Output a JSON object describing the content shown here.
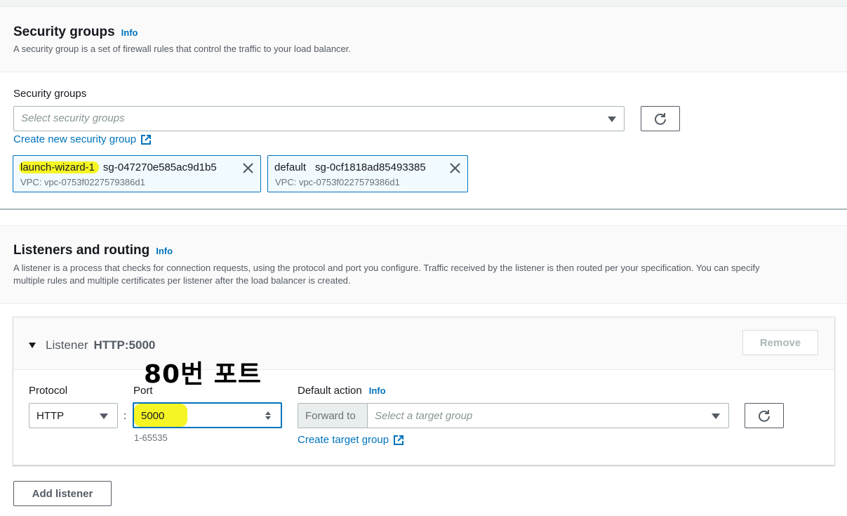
{
  "security_groups": {
    "title": "Security groups",
    "info": "Info",
    "description": "A security group is a set of firewall rules that control the traffic to your load balancer.",
    "field_label": "Security groups",
    "select_placeholder": "Select security groups",
    "create_link": "Create new security group",
    "selected": [
      {
        "name": "launch-wizard-1",
        "id": "sg-047270e585ac9d1b5",
        "vpc": "VPC: vpc-0753f0227579386d1"
      },
      {
        "name": "default",
        "id": "sg-0cf1818ad85493385",
        "vpc": "VPC: vpc-0753f0227579386d1"
      }
    ]
  },
  "listeners": {
    "title": "Listeners and routing",
    "info": "Info",
    "description_line1": "A listener is a process that checks for connection requests, using the protocol and port you configure. Traffic received by the listener is then routed per your specification. You can specify",
    "description_line2": "multiple rules and multiple certificates per listener after the load balancer is created.",
    "listener": {
      "label": "Listener",
      "value": "HTTP:5000",
      "remove_label": "Remove",
      "protocol_label": "Protocol",
      "protocol_value": "HTTP",
      "port_label": "Port",
      "port_value": "5000",
      "port_hint": "1-65535",
      "separator": ":",
      "default_action_label": "Default action",
      "default_action_info": "Info",
      "forward_to": "Forward to",
      "target_placeholder": "Select a target group",
      "create_target_link": "Create target group"
    },
    "add_listener_label": "Add listener"
  },
  "annotation": "80번 포트",
  "colors": {
    "link": "#0073bb",
    "highlight": "#f5f523",
    "text": "#16191f"
  }
}
